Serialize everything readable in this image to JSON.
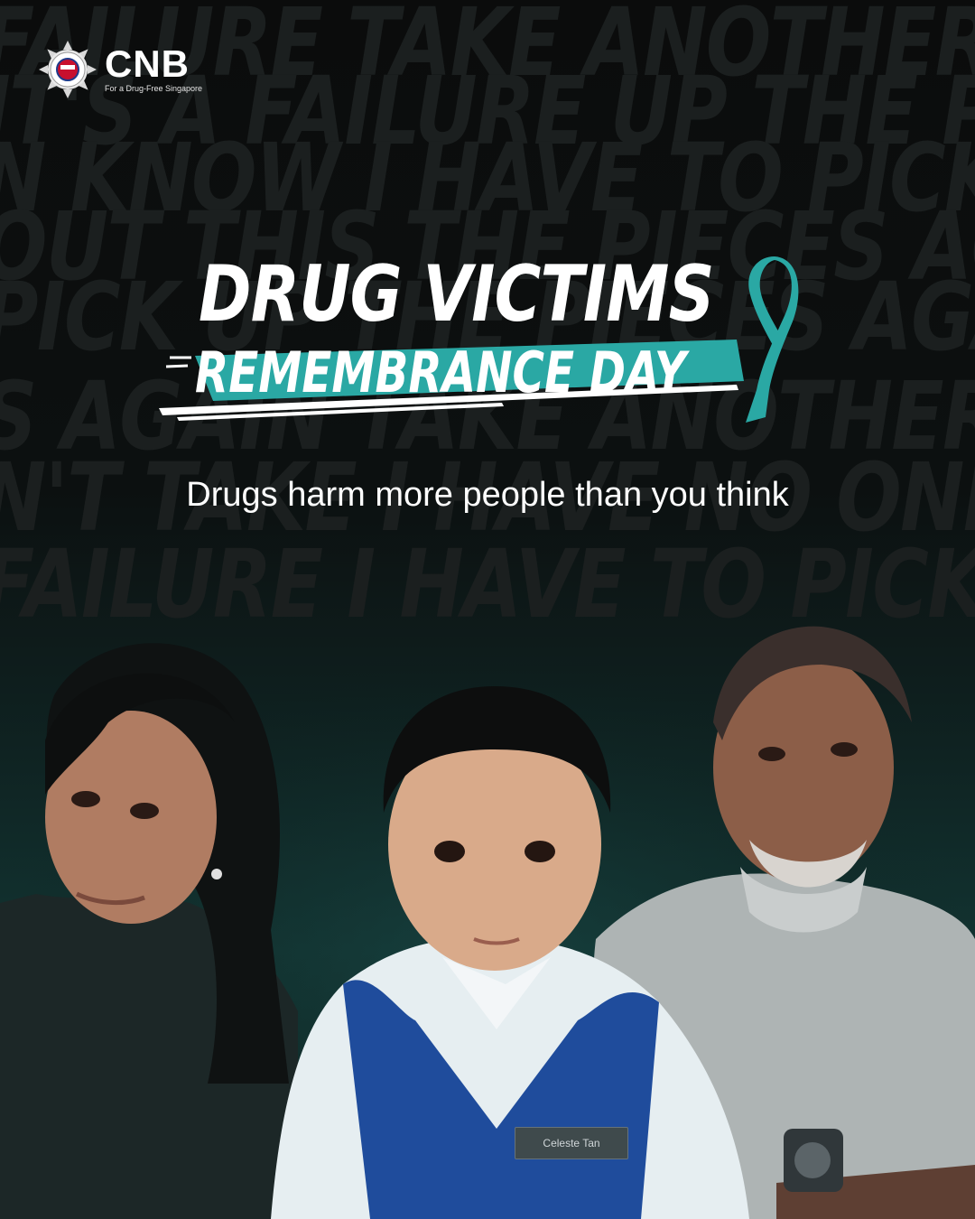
{
  "brand": {
    "name": "CNB",
    "tagline": "For a Drug-Free Singapore",
    "crest_icon": "cnb-crest-icon"
  },
  "background_words": [
    "FAILURE TAKE ANOTHER I HAVE",
    "IT'S A FAILURE UP THE PIEC",
    "N KNOW I HAVE TO PICK UP N",
    "OUT THIS THE PIECES AGAIN",
    "PICK UP THE PIECES AGAIN KNO",
    "S AGAIN TAKE ANOTHER UP TH",
    "N'T TAKE I HAVE NO ONE",
    "FAILURE I HAVE TO PICK UP N"
  ],
  "title": {
    "line1": "DRUG VICTIMS",
    "line2": "REMEMBRANCE DAY"
  },
  "subtitle": "Drugs harm more people than you think",
  "name_tag": "Celeste Tan",
  "colors": {
    "teal_accent": "#2aa8a4",
    "background_dark": "#0b0c0c",
    "background_teal": "#123331"
  }
}
